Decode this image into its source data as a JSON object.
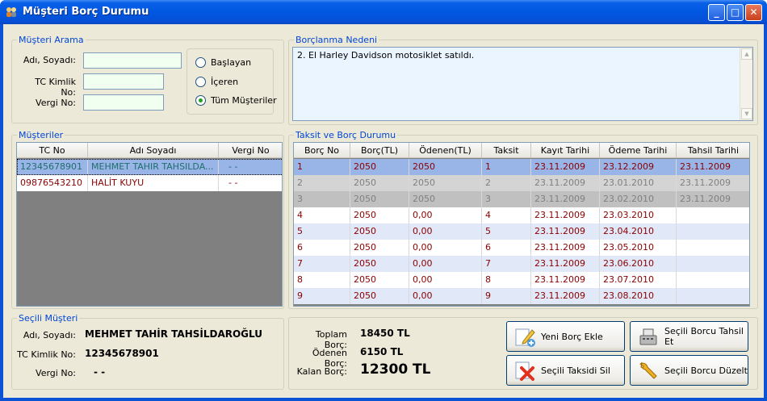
{
  "window": {
    "title": "Müşteri Borç Durumu",
    "min": "_",
    "max": "□",
    "close": "✕"
  },
  "search": {
    "legend": "Müşteri Arama",
    "name_label": "Adı, Soyadı:",
    "tc_label": "TC Kimlik No:",
    "tax_label": "Vergi No:",
    "name_value": "",
    "tc_value": "",
    "tax_value": "",
    "options": [
      "Başlayan",
      "İçeren",
      "Tüm Müşteriler"
    ],
    "selected": "Tüm Müşteriler"
  },
  "reason": {
    "legend": "Borçlanma Nedeni",
    "text": "2. El Harley Davidson motosiklet satıldı."
  },
  "customers": {
    "legend": "Müşteriler",
    "columns": [
      "TC No",
      "Adı Soyadı",
      "Vergi No"
    ],
    "rows": [
      [
        "12345678901",
        "MEHMET TAHIR TAHSILDA...",
        "-  -"
      ],
      [
        "09876543210",
        "HALİT KUYU",
        "-  -"
      ]
    ]
  },
  "installments": {
    "legend": "Taksit ve Borç Durumu",
    "columns": [
      "Borç No",
      "Borç(TL)",
      "Ödenen(TL)",
      "Taksit",
      "Kayıt Tarihi",
      "Ödeme Tarihi",
      "Tahsil Tarihi"
    ],
    "rows": [
      [
        "1",
        "2050",
        "2050",
        "1",
        "23.11.2009",
        "23.12.2009",
        "23.11.2009"
      ],
      [
        "2",
        "2050",
        "2050",
        "2",
        "23.11.2009",
        "23.01.2010",
        "23.11.2009"
      ],
      [
        "3",
        "2050",
        "2050",
        "3",
        "23.11.2009",
        "23.02.2010",
        "23.11.2009"
      ],
      [
        "4",
        "2050",
        "0,00",
        "4",
        "23.11.2009",
        "23.03.2010",
        ""
      ],
      [
        "5",
        "2050",
        "0,00",
        "5",
        "23.11.2009",
        "23.04.2010",
        ""
      ],
      [
        "6",
        "2050",
        "0,00",
        "6",
        "23.11.2009",
        "23.05.2010",
        ""
      ],
      [
        "7",
        "2050",
        "0,00",
        "7",
        "23.11.2009",
        "23.06.2010",
        ""
      ],
      [
        "8",
        "2050",
        "0,00",
        "8",
        "23.11.2009",
        "23.07.2010",
        ""
      ],
      [
        "9",
        "2050",
        "0,00",
        "9",
        "23.11.2009",
        "23.08.2010",
        ""
      ]
    ]
  },
  "selected_customer": {
    "legend": "Seçili Müşteri",
    "name_label": "Adı, Soyadı:",
    "tc_label": "TC Kimlik No:",
    "tax_label": "Vergi No:",
    "name": "MEHMET TAHİR TAHSİLDAROĞLU",
    "tc": "12345678901",
    "tax": "-  -"
  },
  "summary": {
    "total_label": "Toplam Borç:",
    "total": "18450 TL",
    "paid_label": "Ödenen Borç:",
    "paid": "6150 TL",
    "remaining_label": "Kalan Borç:",
    "remaining": "12300 TL"
  },
  "buttons": {
    "add": "Yeni Borç Ekle",
    "collect": "Seçili Borcu Tahsil Et",
    "delete": "Seçili Taksidi Sil",
    "edit": "Seçili Borcu Düzelt"
  },
  "colors": {
    "selected_row": "#99b4e6",
    "paid_row": "#d4d4d4",
    "paid_text": "#808080",
    "unpaid_text": "#8b0000",
    "alt_row": "#e1e8f8"
  }
}
